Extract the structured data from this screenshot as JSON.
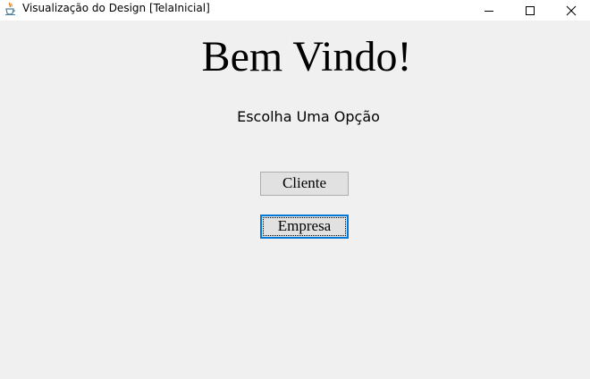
{
  "window": {
    "title": "Visualização do Design [TelaInicial]",
    "icons": {
      "app": "java-coffee-cup-icon",
      "minimize": "minimize-icon",
      "maximize": "maximize-icon",
      "close": "close-icon"
    }
  },
  "main": {
    "heading": "Bem Vindo!",
    "subtitle": "Escolha Uma Opção",
    "buttons": {
      "cliente": "Cliente",
      "empresa": "Empresa"
    }
  },
  "colors": {
    "background": "#f0f0f0",
    "titlebar": "#ffffff",
    "button_face": "#e1e1e1",
    "button_border": "#adadad",
    "focus_border": "#0078d7"
  }
}
